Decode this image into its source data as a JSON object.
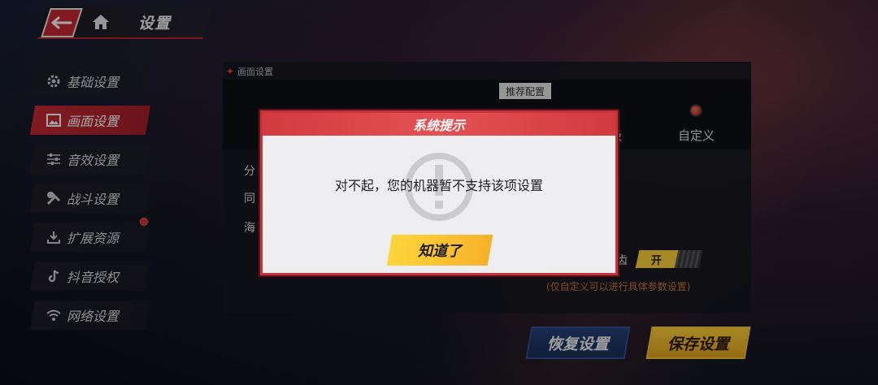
{
  "header": {
    "title": "设置",
    "back_icon": "back-arrow-icon",
    "home_icon": "home-icon"
  },
  "sidebar": {
    "items": [
      {
        "label": "基础设置",
        "icon": "gear-icon",
        "active": false
      },
      {
        "label": "画面设置",
        "icon": "image-icon",
        "active": true
      },
      {
        "label": "音效设置",
        "icon": "equalizer-icon",
        "active": false
      },
      {
        "label": "战斗设置",
        "icon": "battle-icon",
        "active": false
      },
      {
        "label": "扩展资源",
        "icon": "download-icon",
        "active": false
      },
      {
        "label": "抖音授权",
        "icon": "tiktok-icon",
        "active": false
      },
      {
        "label": "网络设置",
        "icon": "wifi-icon",
        "active": false
      }
    ]
  },
  "panel": {
    "title": "画面设置",
    "recommend_tag": "推荐配置",
    "option_partial": "级",
    "option_custom": "自定义",
    "rows": [
      "分",
      "同",
      "海"
    ],
    "toggle_label": "齿",
    "toggle_on": "开",
    "note": "(仅自定义可以进行具体参数设置)"
  },
  "buttons": {
    "restore": "恢复设置",
    "save": "保存设置"
  },
  "dialog": {
    "title": "系统提示",
    "message": "对不起，您的机器暂不支持该项设置",
    "confirm": "知道了"
  },
  "colors": {
    "accent_red": "#c62a33",
    "accent_yellow": "#ffd23a",
    "note_orange": "#c9743a",
    "restore_blue": "#27417a"
  }
}
